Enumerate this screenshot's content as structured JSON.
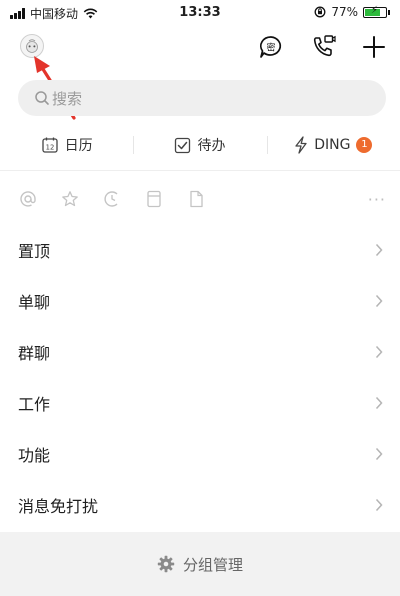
{
  "status_bar": {
    "carrier": "中国移动",
    "time": "13:33",
    "battery": "77%",
    "battery_level": 0.77
  },
  "header": {
    "icons": [
      "avatar",
      "secret-chat-icon",
      "video-call-icon",
      "add-icon"
    ],
    "secret_chat_glyph": "密"
  },
  "search": {
    "placeholder": "搜索"
  },
  "shortcuts": [
    {
      "label": "日历",
      "icon": "calendar-icon",
      "day": "12"
    },
    {
      "label": "待办",
      "icon": "todo-check-icon"
    },
    {
      "label": "DING",
      "icon": "lightning-icon",
      "badge": "1"
    }
  ],
  "filters": [
    "at-icon",
    "star-icon",
    "later-icon",
    "bookmark-icon",
    "document-icon",
    "more-icon"
  ],
  "filter_more": "···",
  "list": [
    {
      "label": "置顶"
    },
    {
      "label": "单聊"
    },
    {
      "label": "群聊"
    },
    {
      "label": "工作"
    },
    {
      "label": "功能"
    },
    {
      "label": "消息免打扰"
    }
  ],
  "bottom": {
    "label": "分组管理",
    "icon": "gear-icon"
  },
  "colors": {
    "badge": "#ee6b2e",
    "arrow": "#e3342b",
    "battery": "#2dba3c"
  }
}
